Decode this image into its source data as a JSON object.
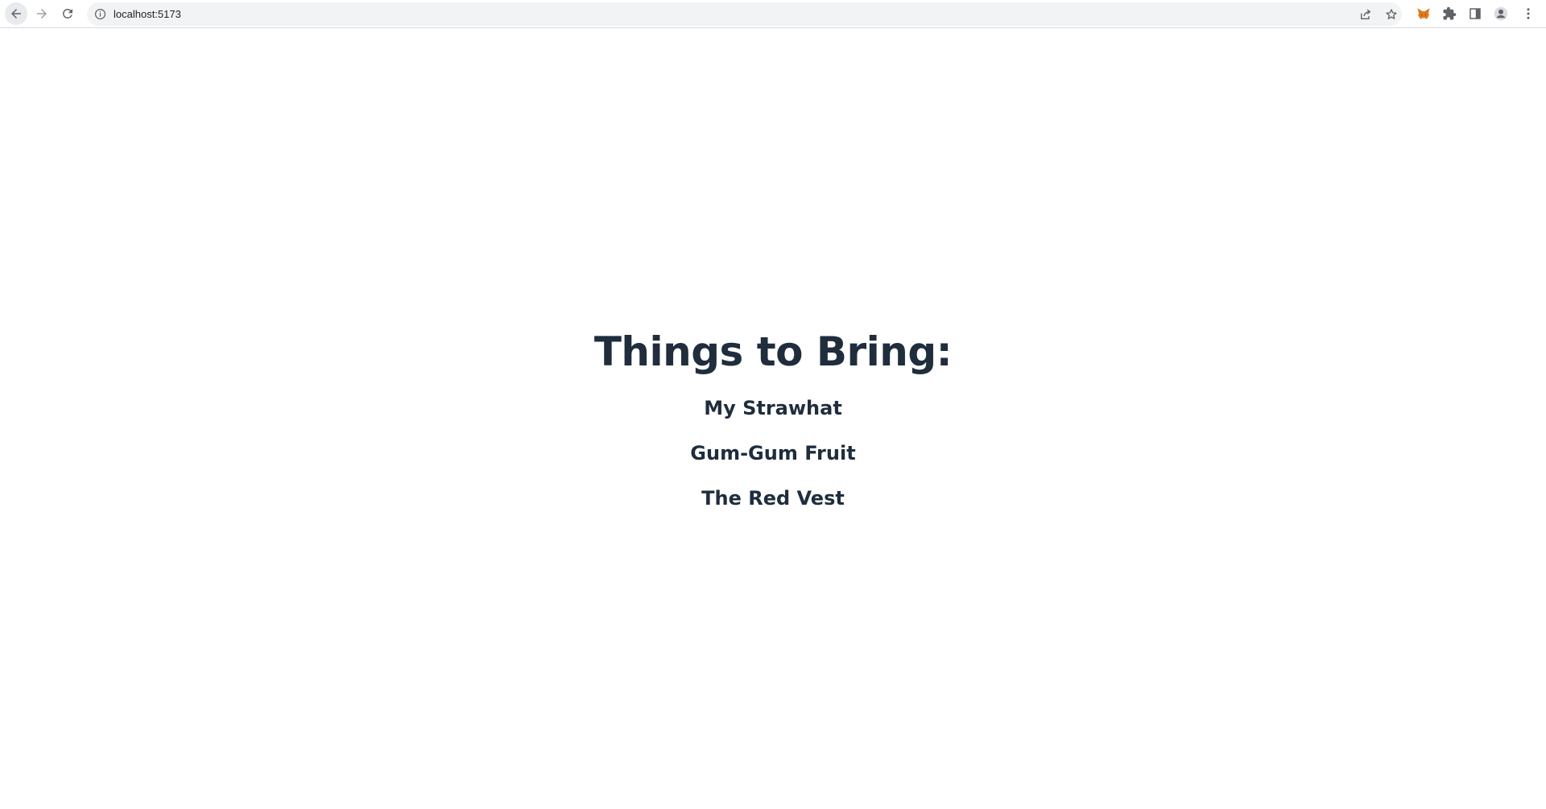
{
  "browser": {
    "url": "localhost:5173",
    "icons": {
      "back": "arrow-left-icon",
      "forward": "arrow-right-icon",
      "reload": "reload-icon",
      "site_info": "info-icon",
      "share": "share-icon",
      "bookmark": "star-icon",
      "metamask": "fox-icon",
      "extensions": "puzzle-icon",
      "side_panel": "side-panel-icon",
      "profile": "profile-icon",
      "menu": "kebab-menu-icon"
    }
  },
  "page": {
    "title": "Things to Bring:",
    "items": [
      "My Strawhat",
      "Gum-Gum Fruit",
      "The Red Vest"
    ]
  },
  "colors": {
    "text": "#1f2d3d",
    "background": "#ffffff",
    "omnibox": "#f1f3f4"
  }
}
